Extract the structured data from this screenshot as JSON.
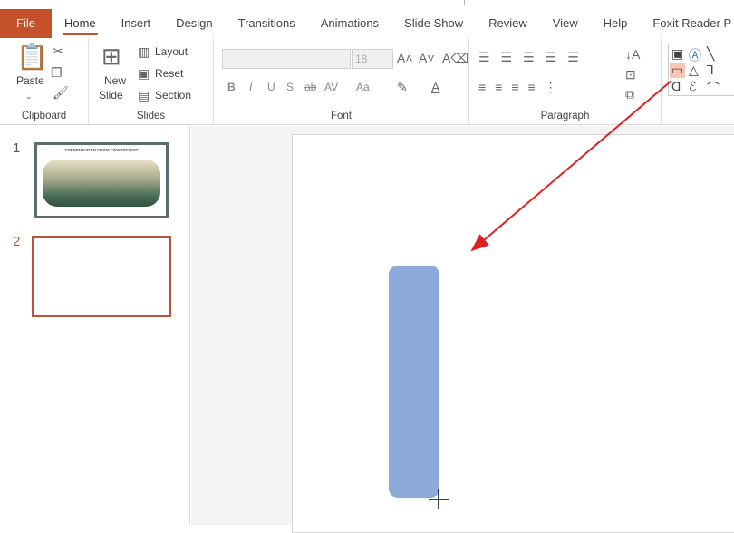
{
  "tabs": [
    "File",
    "Home",
    "Insert",
    "Design",
    "Transitions",
    "Animations",
    "Slide Show",
    "Review",
    "View",
    "Help",
    "Foxit Reader P"
  ],
  "active_tab": "Home",
  "clipboard": {
    "paste": "Paste",
    "label": "Clipboard"
  },
  "slides_group": {
    "new_slide_1": "New",
    "new_slide_2": "Slide",
    "layout": "Layout",
    "reset": "Reset",
    "section": "Section",
    "label": "Slides"
  },
  "font": {
    "name": "",
    "size": "18",
    "label": "Font",
    "bold": "B",
    "italic": "I",
    "underline": "U",
    "shadow": "S",
    "strike": "ab",
    "spacing": "AV",
    "case": "Aa"
  },
  "paragraph": {
    "label": "Paragraph"
  },
  "thumbnails": [
    {
      "number": "1",
      "title": "PRESENTATION FROM POWERPOINT"
    },
    {
      "number": "2",
      "selected": true
    }
  ],
  "colors": {
    "accent": "#c4512a",
    "shape_fill": "#8eaadb",
    "arrow": "#e02020"
  }
}
